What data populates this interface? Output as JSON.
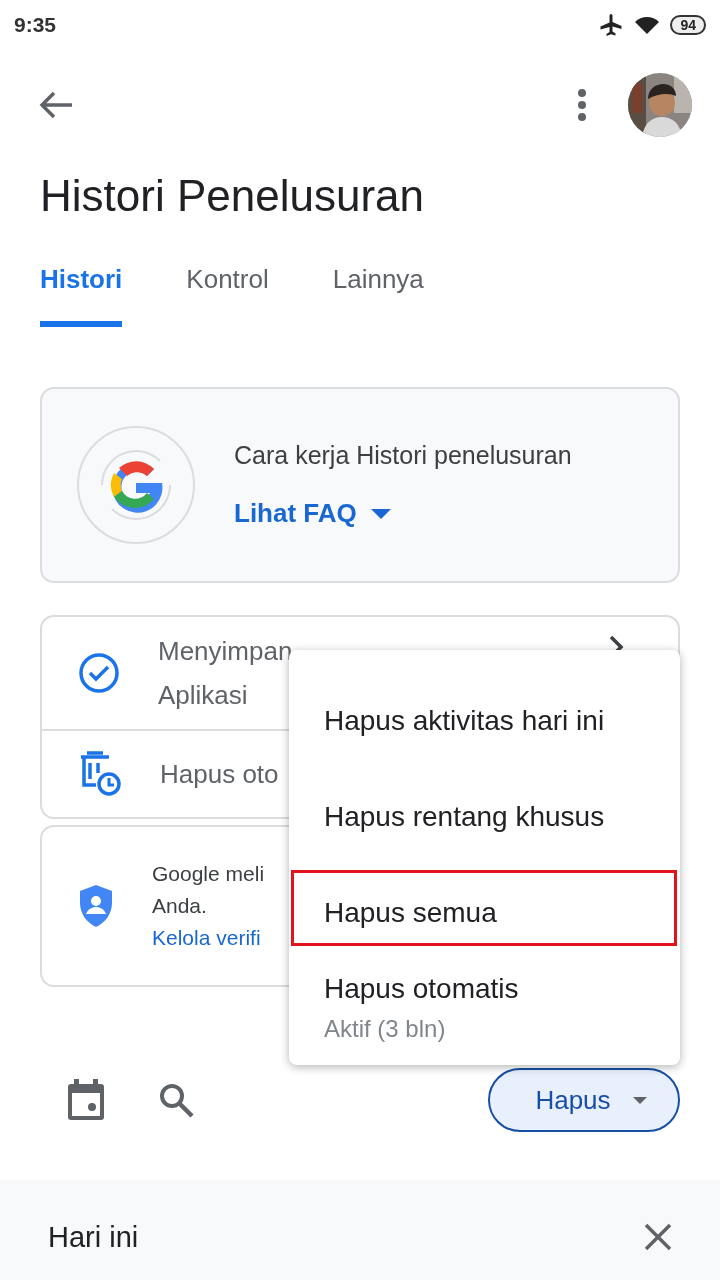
{
  "status_bar": {
    "time": "9:35",
    "battery": "94"
  },
  "header": {
    "title": "Histori Penelusuran"
  },
  "tabs": [
    {
      "label": "Histori",
      "selected": true
    },
    {
      "label": "Kontrol",
      "selected": false
    },
    {
      "label": "Lainnya",
      "selected": false
    }
  ],
  "faq_card": {
    "title": "Cara kerja Histori penelusuran",
    "link": "Lihat FAQ"
  },
  "settings_card": {
    "rows": [
      {
        "kind": "saving",
        "lines": [
          "Menyimpan",
          "Aplikasi"
        ]
      },
      {
        "kind": "auto_delete",
        "lines": [
          "Hapus oto"
        ]
      }
    ]
  },
  "verification_card": {
    "lines": [
      "Google meli",
      "Anda."
    ],
    "link": "Kelola verifi"
  },
  "toolbar": {
    "delete_button": "Hapus"
  },
  "menu": {
    "items": [
      {
        "label": "Hapus aktivitas hari ini",
        "highlighted": false
      },
      {
        "label": "Hapus rentang khusus",
        "highlighted": false
      },
      {
        "label": "Hapus semua",
        "highlighted": true
      },
      {
        "label": "Hapus otomatis",
        "sublabel": "Aktif (3 bln)",
        "highlighted": false
      }
    ]
  },
  "section": {
    "title": "Hari ini"
  }
}
